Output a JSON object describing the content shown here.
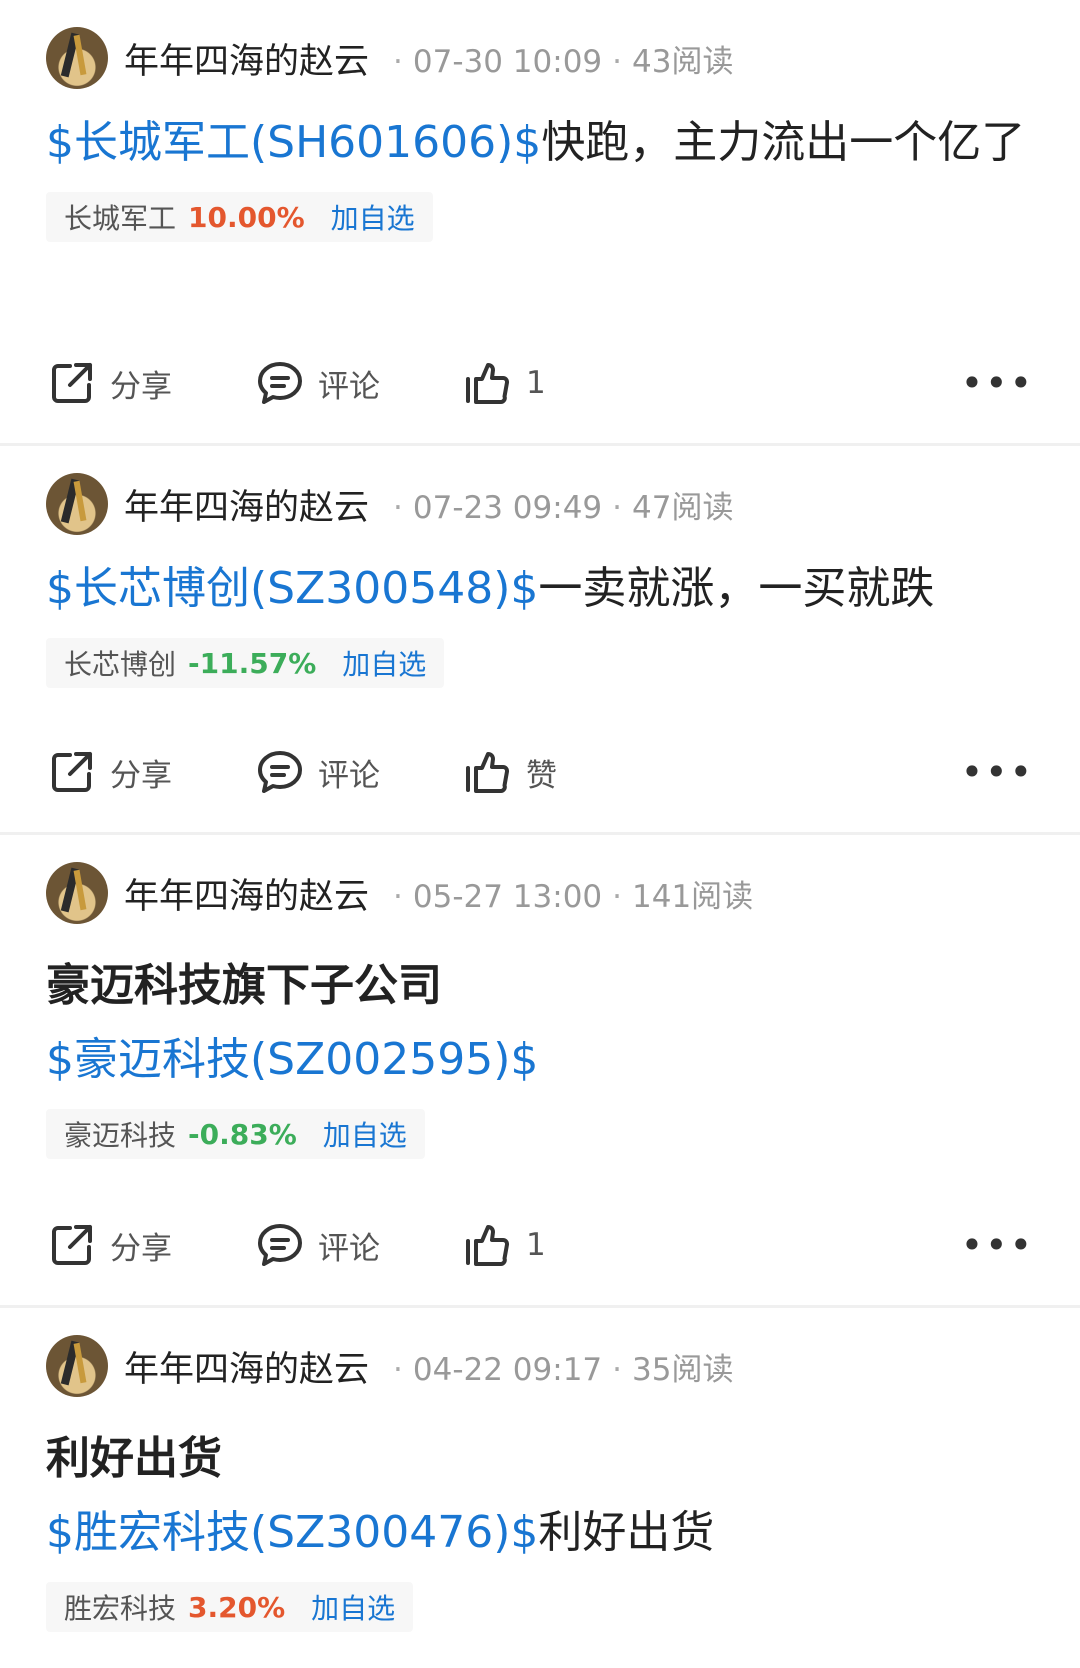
{
  "posts": [
    {
      "author": "年年四海的赵云",
      "date": "07-30 10:09",
      "reads": "43阅读",
      "title": "",
      "link": "$长城军工(SH601606)$",
      "text": "快跑，主力流出一个亿了",
      "stock": {
        "name": "长城军工",
        "change": "10.00%",
        "direction": "up",
        "add": "加自选"
      },
      "share": "分享",
      "comment": "评论",
      "like": "1"
    },
    {
      "author": "年年四海的赵云",
      "date": "07-23 09:49",
      "reads": "47阅读",
      "title": "",
      "link": "$长芯博创(SZ300548)$",
      "text": "一卖就涨，一买就跌",
      "stock": {
        "name": "长芯博创",
        "change": "-11.57%",
        "direction": "down",
        "add": "加自选"
      },
      "share": "分享",
      "comment": "评论",
      "like": "赞"
    },
    {
      "author": "年年四海的赵云",
      "date": "05-27 13:00",
      "reads": "141阅读",
      "title": "豪迈科技旗下子公司",
      "link": "$豪迈科技(SZ002595)$",
      "text": "",
      "stock": {
        "name": "豪迈科技",
        "change": "-0.83%",
        "direction": "down",
        "add": "加自选"
      },
      "share": "分享",
      "comment": "评论",
      "like": "1"
    },
    {
      "author": "年年四海的赵云",
      "date": "04-22 09:17",
      "reads": "35阅读",
      "title": "利好出货",
      "link": "$胜宏科技(SZ300476)$",
      "text": "利好出货",
      "stock": {
        "name": "胜宏科技",
        "change": "3.20%",
        "direction": "up",
        "add": "加自选"
      }
    }
  ],
  "colors": {
    "link": "#1976d2",
    "up": "#e4572e",
    "down": "#3cad5a"
  },
  "icons": [
    "share-icon",
    "comment-icon",
    "like-icon",
    "more-icon"
  ],
  "separator": "·",
  "more": "•••"
}
